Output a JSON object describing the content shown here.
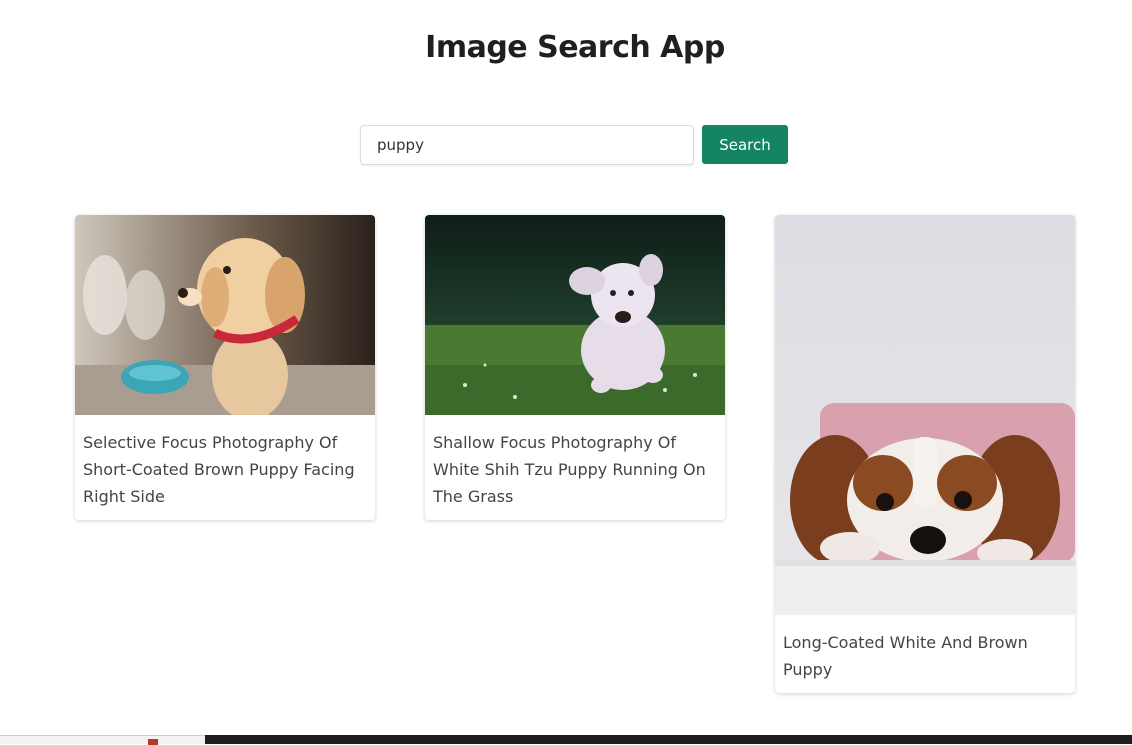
{
  "app": {
    "title": "Image Search App"
  },
  "search": {
    "value": "puppy",
    "button_label": "Search"
  },
  "results": [
    {
      "caption": "Selective Focus Photography Of Short-Coated Brown Puppy Facing Right Side"
    },
    {
      "caption": "Shallow Focus Photography Of White Shih Tzu Puppy Running On The Grass"
    },
    {
      "caption": "Long-Coated White And Brown Puppy"
    }
  ],
  "colors": {
    "accent": "#158465",
    "title": "#1f1f1f",
    "caption": "#444444"
  }
}
